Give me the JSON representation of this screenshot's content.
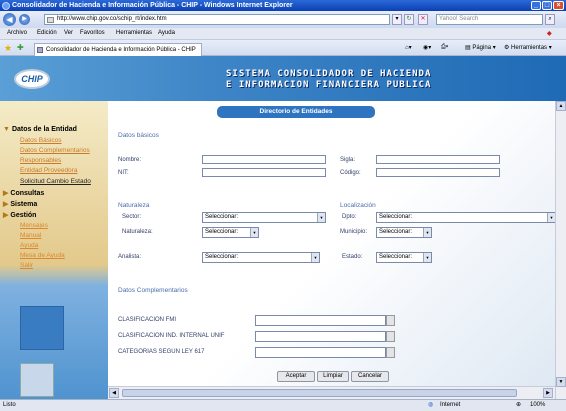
{
  "window": {
    "title": "Consolidador de Hacienda e Información Pública - CHIP - Windows Internet Explorer"
  },
  "browser": {
    "url": "http://www.chip.gov.co/schip_rt/index.htm",
    "search_placeholder": "Yahoo! Search",
    "menu": [
      "Archivo",
      "Edición",
      "Ver",
      "Favoritos",
      "Herramientas",
      "Ayuda"
    ],
    "tab_title": "Consolidador de Hacienda e Información Pública - CHIP",
    "toolbar_page": "Página",
    "toolbar_tools": "Herramientas"
  },
  "header": {
    "logo": "CHIP",
    "system_line1": "SISTEMA CONSOLIDADOR DE HACIENDA",
    "system_line2": "E INFORMACION FINANCIERA PUBLICA"
  },
  "sidebar": {
    "sections": [
      {
        "label": "Datos de la Entidad",
        "items": [
          "Datos Básicos",
          "Datos Complementarios",
          "Responsables",
          "Entidad Proveedora",
          "Solicitud Cambio Estado"
        ]
      },
      {
        "label": "Consultas",
        "items": []
      },
      {
        "label": "Sistema",
        "items": []
      },
      {
        "label": "Gestión",
        "items": [
          "Mensajes",
          "Manual",
          "Ayuda",
          "Mesa de Ayuda",
          "Salir"
        ]
      }
    ]
  },
  "form": {
    "title": "Directorio de Entidades",
    "basic_header": "Datos básicos",
    "nombre_label": "Nombre:",
    "nit_label": "NIT:",
    "sigla_label": "Sigla:",
    "codigo_label": "Código:",
    "naturaleza_header": "Naturaleza",
    "localizacion_header": "Localización",
    "sector_label": "Sector:",
    "sector_value": "Seleccionar:",
    "naturaleza_label": "Naturaleza:",
    "naturaleza_value": "Seleccionar:",
    "dpto_label": "Dpto:",
    "dpto_value": "Seleccionar:",
    "municipio_label": "Municipio:",
    "municipio_value": "Seleccionar:",
    "analista_label": "Analista:",
    "analista_value": "Seleccionar:",
    "estado_label": "Estado:",
    "estado_value": "Seleccionar:",
    "complementarios_header": "Datos Complementarios",
    "clasificacion_fmi": "CLASIFICACION FMI",
    "clasificacion_ind": "CLASIFICACION IND. INTERNAL UNIF",
    "categorias_ley": "CATEGORIAS SEGUN LEY 617",
    "btn_aceptar": "Aceptar",
    "btn_limpiar": "Limpiar",
    "btn_cancelar": "Cancelar"
  },
  "status": {
    "left": "Listo",
    "zone": "Internet",
    "zoom": "100%"
  }
}
